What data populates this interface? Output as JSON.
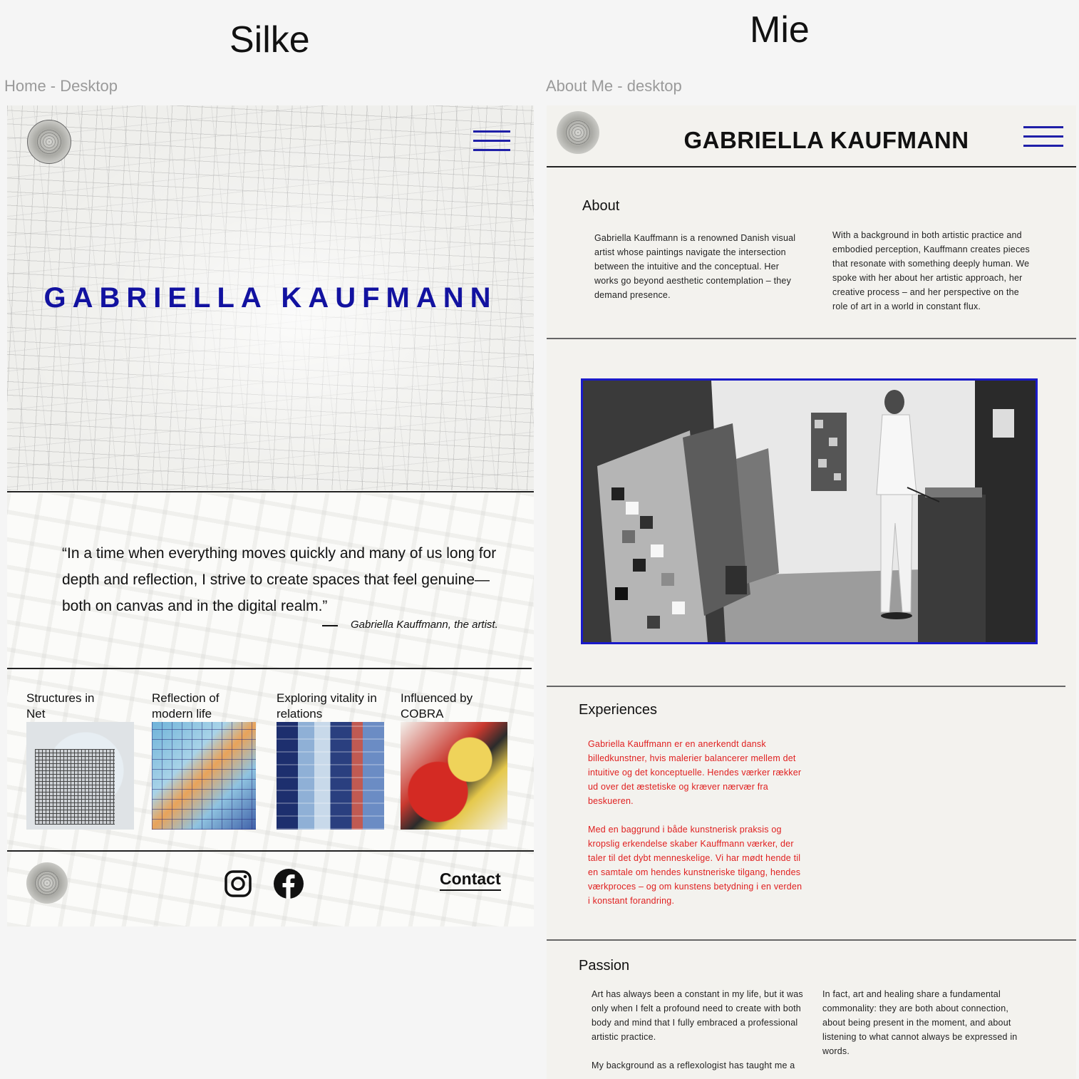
{
  "headings": {
    "left_designer": "Silke",
    "right_designer": "Mie",
    "left_frame_label": "Home - Desktop",
    "right_frame_label": "About Me - desktop"
  },
  "silke": {
    "hero_name": "GABRIELLA KAUFMANN",
    "quote": "“In a time when everything moves quickly and many of us long for depth and reflection, I strive to create spaces that feel genuine—both on canvas and in the digital realm.”",
    "quote_author": "Gabriella Kauffmann, the artist.",
    "works": [
      {
        "title": "Structures in Net"
      },
      {
        "title": "Reflection of modern life"
      },
      {
        "title": "Exploring vitality in relations"
      },
      {
        "title": "Influenced by COBRA"
      }
    ],
    "footer": {
      "instagram_icon": "instagram-icon",
      "facebook_icon": "facebook-icon",
      "contact_label": "Contact"
    }
  },
  "mie": {
    "brand": "GABRIELLA KAUFMANN",
    "about": {
      "title": "About",
      "col1": "Gabriella Kauffmann is a renowned Danish visual artist whose paintings navigate the intersection between the intuitive and the conceptual. Her works go beyond aesthetic contemplation – they demand presence.",
      "col2": "With a background in both artistic practice and embodied perception, Kauffmann creates pieces that resonate with something deeply human. We spoke with her about her artistic approach, her creative process – and her perspective on the role of art in a world in constant flux."
    },
    "experiences": {
      "title": "Experiences",
      "p1": "Gabriella Kauffmann er en anerkendt dansk billedkunstner, hvis malerier balancerer mellem det intuitive og det konceptuelle. Hendes værker rækker ud over det æstetiske og kræver nærvær fra beskueren.",
      "p2": "Med en baggrund i både kunstnerisk praksis og kropslig erkendelse skaber Kauffmann værker, der taler til det dybt menneskelige. Vi har mødt hende til en samtale om hendes kunstneriske tilgang, hendes værkproces – og om kunstens betydning i en verden i konstant forandring.",
      "text_color": "#e02020"
    },
    "passion": {
      "title": "Passion",
      "col1_p1": "Art has always been a constant in my life, but it was only when I felt a profound need to create with both body and mind that I fully embraced a professional artistic practice.",
      "col1_p2": "My background as a reflexologist has taught me a",
      "col2_p1": "In fact, art and healing share a fundamental commonality: they are both about connection, about being present in the moment, and about listening to what cannot always be expressed in words."
    }
  },
  "colors": {
    "accent_blue": "#1212a0",
    "frame_border_blue": "#1a1ac8"
  }
}
